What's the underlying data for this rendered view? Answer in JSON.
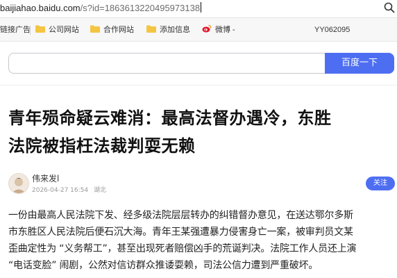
{
  "address_bar": {
    "host": "baijiahao.baidu.com",
    "path": "/s?id=1863613220495973138"
  },
  "bookmarks": [
    {
      "label": "链接广告",
      "icon": "none"
    },
    {
      "label": "公司网站",
      "icon": "folder-icon"
    },
    {
      "label": "合作网站",
      "icon": "folder-icon"
    },
    {
      "label": "添加信息",
      "icon": "folder-icon"
    },
    {
      "label": "微博 -",
      "icon": "weibo-icon"
    },
    {
      "label": "YY062095",
      "icon": "none"
    }
  ],
  "search": {
    "value": "",
    "button_label": "百度一下"
  },
  "article": {
    "title_line1": "青年殒命疑云难消：最高法督办遇冷，东胜",
    "title_line2": "法院被指枉法裁判耍无赖",
    "author": "伟来发l",
    "date": "2026-04-27 16:54",
    "location": "湖北",
    "follow_label": "关注",
    "paragraph_lines": [
      "一份由最高人民法院下发、经多级法院层层转办的纠错督办意见，在送达鄂尔多斯",
      "市东胜区人民法院后便石沉大海。青年王某强遭暴力侵害身亡一案，被审判员文某",
      "歪曲定性为 “义务帮工”，甚至出现死者赔偿凶手的荒诞判决。法院工作人员还上演",
      "“电话变脸” 闹剧，公然对信访群众推诿耍赖，司法公信力遭到严重破坏。"
    ]
  },
  "colors": {
    "accent": "#4e6ef2",
    "folder": "#f4c542",
    "weibo": "#e6162d"
  }
}
